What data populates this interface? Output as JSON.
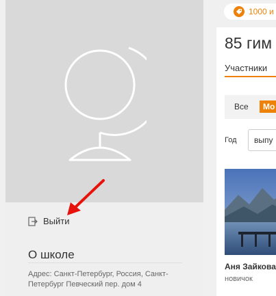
{
  "left": {
    "logout_label": "Выйти",
    "about_title": "О школе",
    "address": "Адрес: Санкт-Петербург, Россия, Санкт-Петербург Певческий пер. дом 4"
  },
  "promo": {
    "text": "1000 и",
    "icon": "tag-icon"
  },
  "group": {
    "title": "85 гим",
    "tab_members": "Участники",
    "filter_all": "Все",
    "filter_active": "Мо",
    "year_label": "Год",
    "year_value": "выпу"
  },
  "member": {
    "name": "Аня Зайкова",
    "status": "новичок"
  },
  "colors": {
    "accent": "#ee8208",
    "annotation_arrow": "#e8120c",
    "cover_bg": "#d9d9d9"
  }
}
